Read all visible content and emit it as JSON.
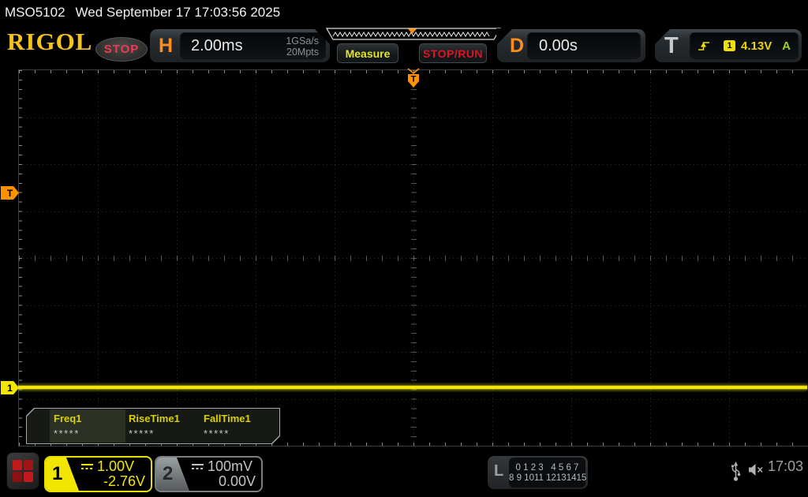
{
  "titlebar": {
    "model": "MSO5102",
    "datetime": "Wed September 17 17:03:56 2025"
  },
  "toolbar": {
    "logo": "RIGOL",
    "run_state": "STOP",
    "horizontal": {
      "label": "H",
      "timebase": "2.00ms",
      "sample_rate": "1GSa/s",
      "memory_depth": "20Mpts"
    },
    "measure_label": "Measure",
    "stop_run_label": "STOP/RUN",
    "delay": {
      "label": "D",
      "value": "0.00s"
    },
    "trigger": {
      "label": "T",
      "source_channel": "1",
      "level": "4.13V",
      "sweep_mode": "A"
    }
  },
  "display": {
    "trigger_position_marker": "T",
    "trigger_level_marker": "T",
    "channel1_marker": "1"
  },
  "measure_panel": {
    "items": [
      {
        "label": "Freq1",
        "value": "*****"
      },
      {
        "label": "RiseTime1",
        "value": "*****"
      },
      {
        "label": "FallTime1",
        "value": "*****"
      }
    ]
  },
  "bottombar": {
    "ch1": {
      "number": "1",
      "scale": "1.00V",
      "offset": "-2.76V"
    },
    "ch2": {
      "number": "2",
      "scale": "100mV",
      "offset": "0.00V"
    },
    "logic": {
      "label": "L",
      "row1": "0 1 2 3   4 5 6 7",
      "row2": "8 9 1011 12131415"
    },
    "clock": "17:03"
  },
  "colors": {
    "channel1_yellow": "#f0e600",
    "channel2_gray": "#c0c4c6",
    "trigger_orange": "#ff9000",
    "stop_text_red": "#ef3a55",
    "stoprun_red": "#e01222",
    "auto_mode_green": "#9ad22a",
    "logo_gold": "#f5c41a"
  }
}
